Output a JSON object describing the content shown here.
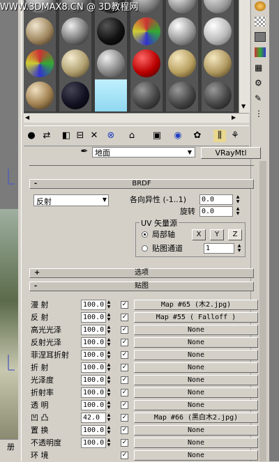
{
  "watermark": {
    "site": "WWW.3DMAX8.CN @ 3D教程网"
  },
  "material": {
    "name": "地面",
    "type_button": "VRayMtl"
  },
  "brdf": {
    "title": "BRDF",
    "type_value": "反射",
    "anisotropy_label": "各向异性 (-1..1)",
    "anisotropy_value": "0.0",
    "rotation_label": "旋转",
    "rotation_value": "0.0",
    "uv_group_label": "UV 矢量源",
    "local_axis_label": "局部轴",
    "axis_x": "X",
    "axis_y": "Y",
    "axis_z": "Z",
    "map_channel_label": "贴图通道",
    "map_channel_value": "1"
  },
  "rollups": {
    "options": "选项",
    "maps": "贴图",
    "plus": "+",
    "minus": "-"
  },
  "maps": [
    {
      "label": "漫  射",
      "amount": "100.0",
      "map": "Map #65 (木2.jpg)"
    },
    {
      "label": "反  射",
      "amount": "100.0",
      "map": "Map #55  ( Falloff )"
    },
    {
      "label": "高光光泽",
      "amount": "100.0",
      "map": "None"
    },
    {
      "label": "反射光泽",
      "amount": "100.0",
      "map": "None"
    },
    {
      "label": "菲涅耳折射",
      "amount": "100.0",
      "map": "None"
    },
    {
      "label": "折  射",
      "amount": "100.0",
      "map": "None"
    },
    {
      "label": "光泽度",
      "amount": "100.0",
      "map": "None"
    },
    {
      "label": "折射率",
      "amount": "100.0",
      "map": "None"
    },
    {
      "label": "透  明",
      "amount": "100.0",
      "map": "None"
    },
    {
      "label": "凹  凸",
      "amount": "42.0",
      "map": "Map #66 (黑白木2.jpg)"
    },
    {
      "label": "置  换",
      "amount": "100.0",
      "map": "None"
    },
    {
      "label": "不透明度",
      "amount": "100.0",
      "map": "None"
    },
    {
      "label": "环  境",
      "amount": "",
      "map": "None"
    }
  ],
  "viewport": {
    "tab_label": "册"
  },
  "colors": {
    "panel": "#d4d0c8",
    "slot_bg": "#3a3a3a"
  }
}
